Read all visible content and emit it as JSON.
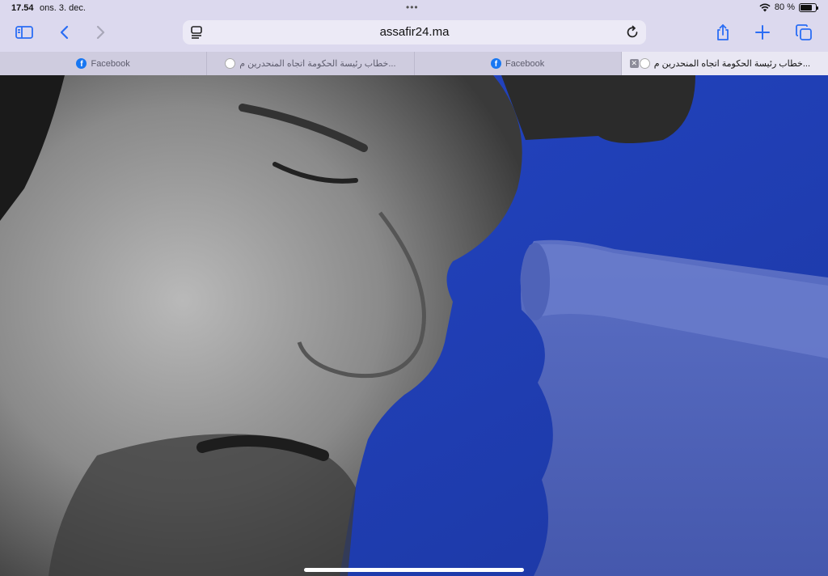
{
  "status_bar": {
    "time": "17.54",
    "date": "ons. 3. dec.",
    "battery_text": "80 %",
    "battery_level": 0.8
  },
  "toolbar": {
    "url": "assafir24.ma"
  },
  "tabs": [
    {
      "label": "Facebook",
      "icon": "facebook-icon",
      "active": false
    },
    {
      "label": "خطاب رئيسة الحكومة اتجاه المنحدرين م...",
      "icon": "site-icon",
      "active": false
    },
    {
      "label": "Facebook",
      "icon": "facebook-icon",
      "active": false
    },
    {
      "label": "خطاب رئيسة الحكومة اتجاه المنحدرين م...",
      "icon": "site-icon",
      "active": true
    }
  ],
  "colors": {
    "accent": "#2a6df4",
    "chrome": "#dcd9ee",
    "hero_blue": "#1f3fae"
  }
}
